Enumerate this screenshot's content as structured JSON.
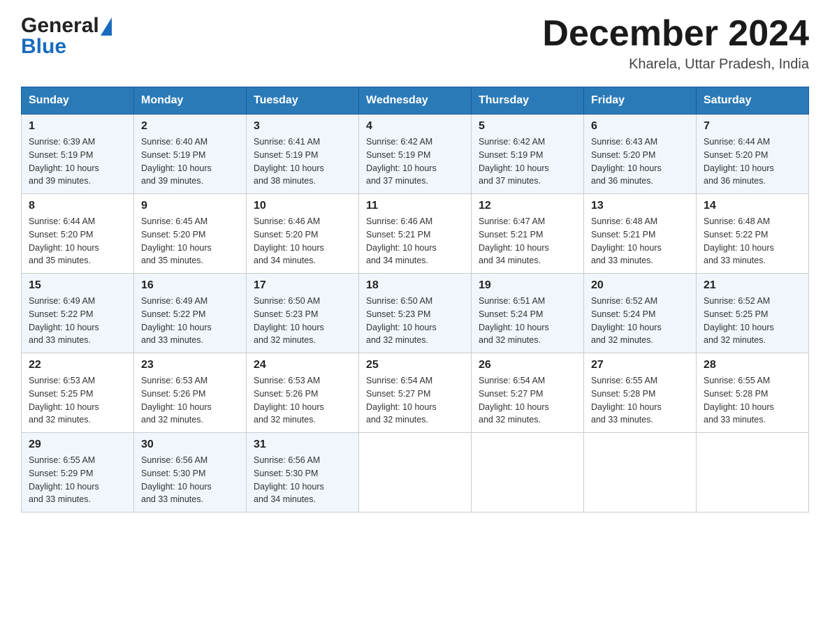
{
  "logo": {
    "general": "General",
    "blue": "Blue"
  },
  "header": {
    "month": "December 2024",
    "location": "Kharela, Uttar Pradesh, India"
  },
  "days": [
    "Sunday",
    "Monday",
    "Tuesday",
    "Wednesday",
    "Thursday",
    "Friday",
    "Saturday"
  ],
  "weeks": [
    [
      {
        "num": "1",
        "sunrise": "6:39 AM",
        "sunset": "5:19 PM",
        "daylight": "10 hours and 39 minutes."
      },
      {
        "num": "2",
        "sunrise": "6:40 AM",
        "sunset": "5:19 PM",
        "daylight": "10 hours and 39 minutes."
      },
      {
        "num": "3",
        "sunrise": "6:41 AM",
        "sunset": "5:19 PM",
        "daylight": "10 hours and 38 minutes."
      },
      {
        "num": "4",
        "sunrise": "6:42 AM",
        "sunset": "5:19 PM",
        "daylight": "10 hours and 37 minutes."
      },
      {
        "num": "5",
        "sunrise": "6:42 AM",
        "sunset": "5:19 PM",
        "daylight": "10 hours and 37 minutes."
      },
      {
        "num": "6",
        "sunrise": "6:43 AM",
        "sunset": "5:20 PM",
        "daylight": "10 hours and 36 minutes."
      },
      {
        "num": "7",
        "sunrise": "6:44 AM",
        "sunset": "5:20 PM",
        "daylight": "10 hours and 36 minutes."
      }
    ],
    [
      {
        "num": "8",
        "sunrise": "6:44 AM",
        "sunset": "5:20 PM",
        "daylight": "10 hours and 35 minutes."
      },
      {
        "num": "9",
        "sunrise": "6:45 AM",
        "sunset": "5:20 PM",
        "daylight": "10 hours and 35 minutes."
      },
      {
        "num": "10",
        "sunrise": "6:46 AM",
        "sunset": "5:20 PM",
        "daylight": "10 hours and 34 minutes."
      },
      {
        "num": "11",
        "sunrise": "6:46 AM",
        "sunset": "5:21 PM",
        "daylight": "10 hours and 34 minutes."
      },
      {
        "num": "12",
        "sunrise": "6:47 AM",
        "sunset": "5:21 PM",
        "daylight": "10 hours and 34 minutes."
      },
      {
        "num": "13",
        "sunrise": "6:48 AM",
        "sunset": "5:21 PM",
        "daylight": "10 hours and 33 minutes."
      },
      {
        "num": "14",
        "sunrise": "6:48 AM",
        "sunset": "5:22 PM",
        "daylight": "10 hours and 33 minutes."
      }
    ],
    [
      {
        "num": "15",
        "sunrise": "6:49 AM",
        "sunset": "5:22 PM",
        "daylight": "10 hours and 33 minutes."
      },
      {
        "num": "16",
        "sunrise": "6:49 AM",
        "sunset": "5:22 PM",
        "daylight": "10 hours and 33 minutes."
      },
      {
        "num": "17",
        "sunrise": "6:50 AM",
        "sunset": "5:23 PM",
        "daylight": "10 hours and 32 minutes."
      },
      {
        "num": "18",
        "sunrise": "6:50 AM",
        "sunset": "5:23 PM",
        "daylight": "10 hours and 32 minutes."
      },
      {
        "num": "19",
        "sunrise": "6:51 AM",
        "sunset": "5:24 PM",
        "daylight": "10 hours and 32 minutes."
      },
      {
        "num": "20",
        "sunrise": "6:52 AM",
        "sunset": "5:24 PM",
        "daylight": "10 hours and 32 minutes."
      },
      {
        "num": "21",
        "sunrise": "6:52 AM",
        "sunset": "5:25 PM",
        "daylight": "10 hours and 32 minutes."
      }
    ],
    [
      {
        "num": "22",
        "sunrise": "6:53 AM",
        "sunset": "5:25 PM",
        "daylight": "10 hours and 32 minutes."
      },
      {
        "num": "23",
        "sunrise": "6:53 AM",
        "sunset": "5:26 PM",
        "daylight": "10 hours and 32 minutes."
      },
      {
        "num": "24",
        "sunrise": "6:53 AM",
        "sunset": "5:26 PM",
        "daylight": "10 hours and 32 minutes."
      },
      {
        "num": "25",
        "sunrise": "6:54 AM",
        "sunset": "5:27 PM",
        "daylight": "10 hours and 32 minutes."
      },
      {
        "num": "26",
        "sunrise": "6:54 AM",
        "sunset": "5:27 PM",
        "daylight": "10 hours and 32 minutes."
      },
      {
        "num": "27",
        "sunrise": "6:55 AM",
        "sunset": "5:28 PM",
        "daylight": "10 hours and 33 minutes."
      },
      {
        "num": "28",
        "sunrise": "6:55 AM",
        "sunset": "5:28 PM",
        "daylight": "10 hours and 33 minutes."
      }
    ],
    [
      {
        "num": "29",
        "sunrise": "6:55 AM",
        "sunset": "5:29 PM",
        "daylight": "10 hours and 33 minutes."
      },
      {
        "num": "30",
        "sunrise": "6:56 AM",
        "sunset": "5:30 PM",
        "daylight": "10 hours and 33 minutes."
      },
      {
        "num": "31",
        "sunrise": "6:56 AM",
        "sunset": "5:30 PM",
        "daylight": "10 hours and 34 minutes."
      },
      null,
      null,
      null,
      null
    ]
  ],
  "labels": {
    "sunrise": "Sunrise:",
    "sunset": "Sunset:",
    "daylight": "Daylight:"
  }
}
